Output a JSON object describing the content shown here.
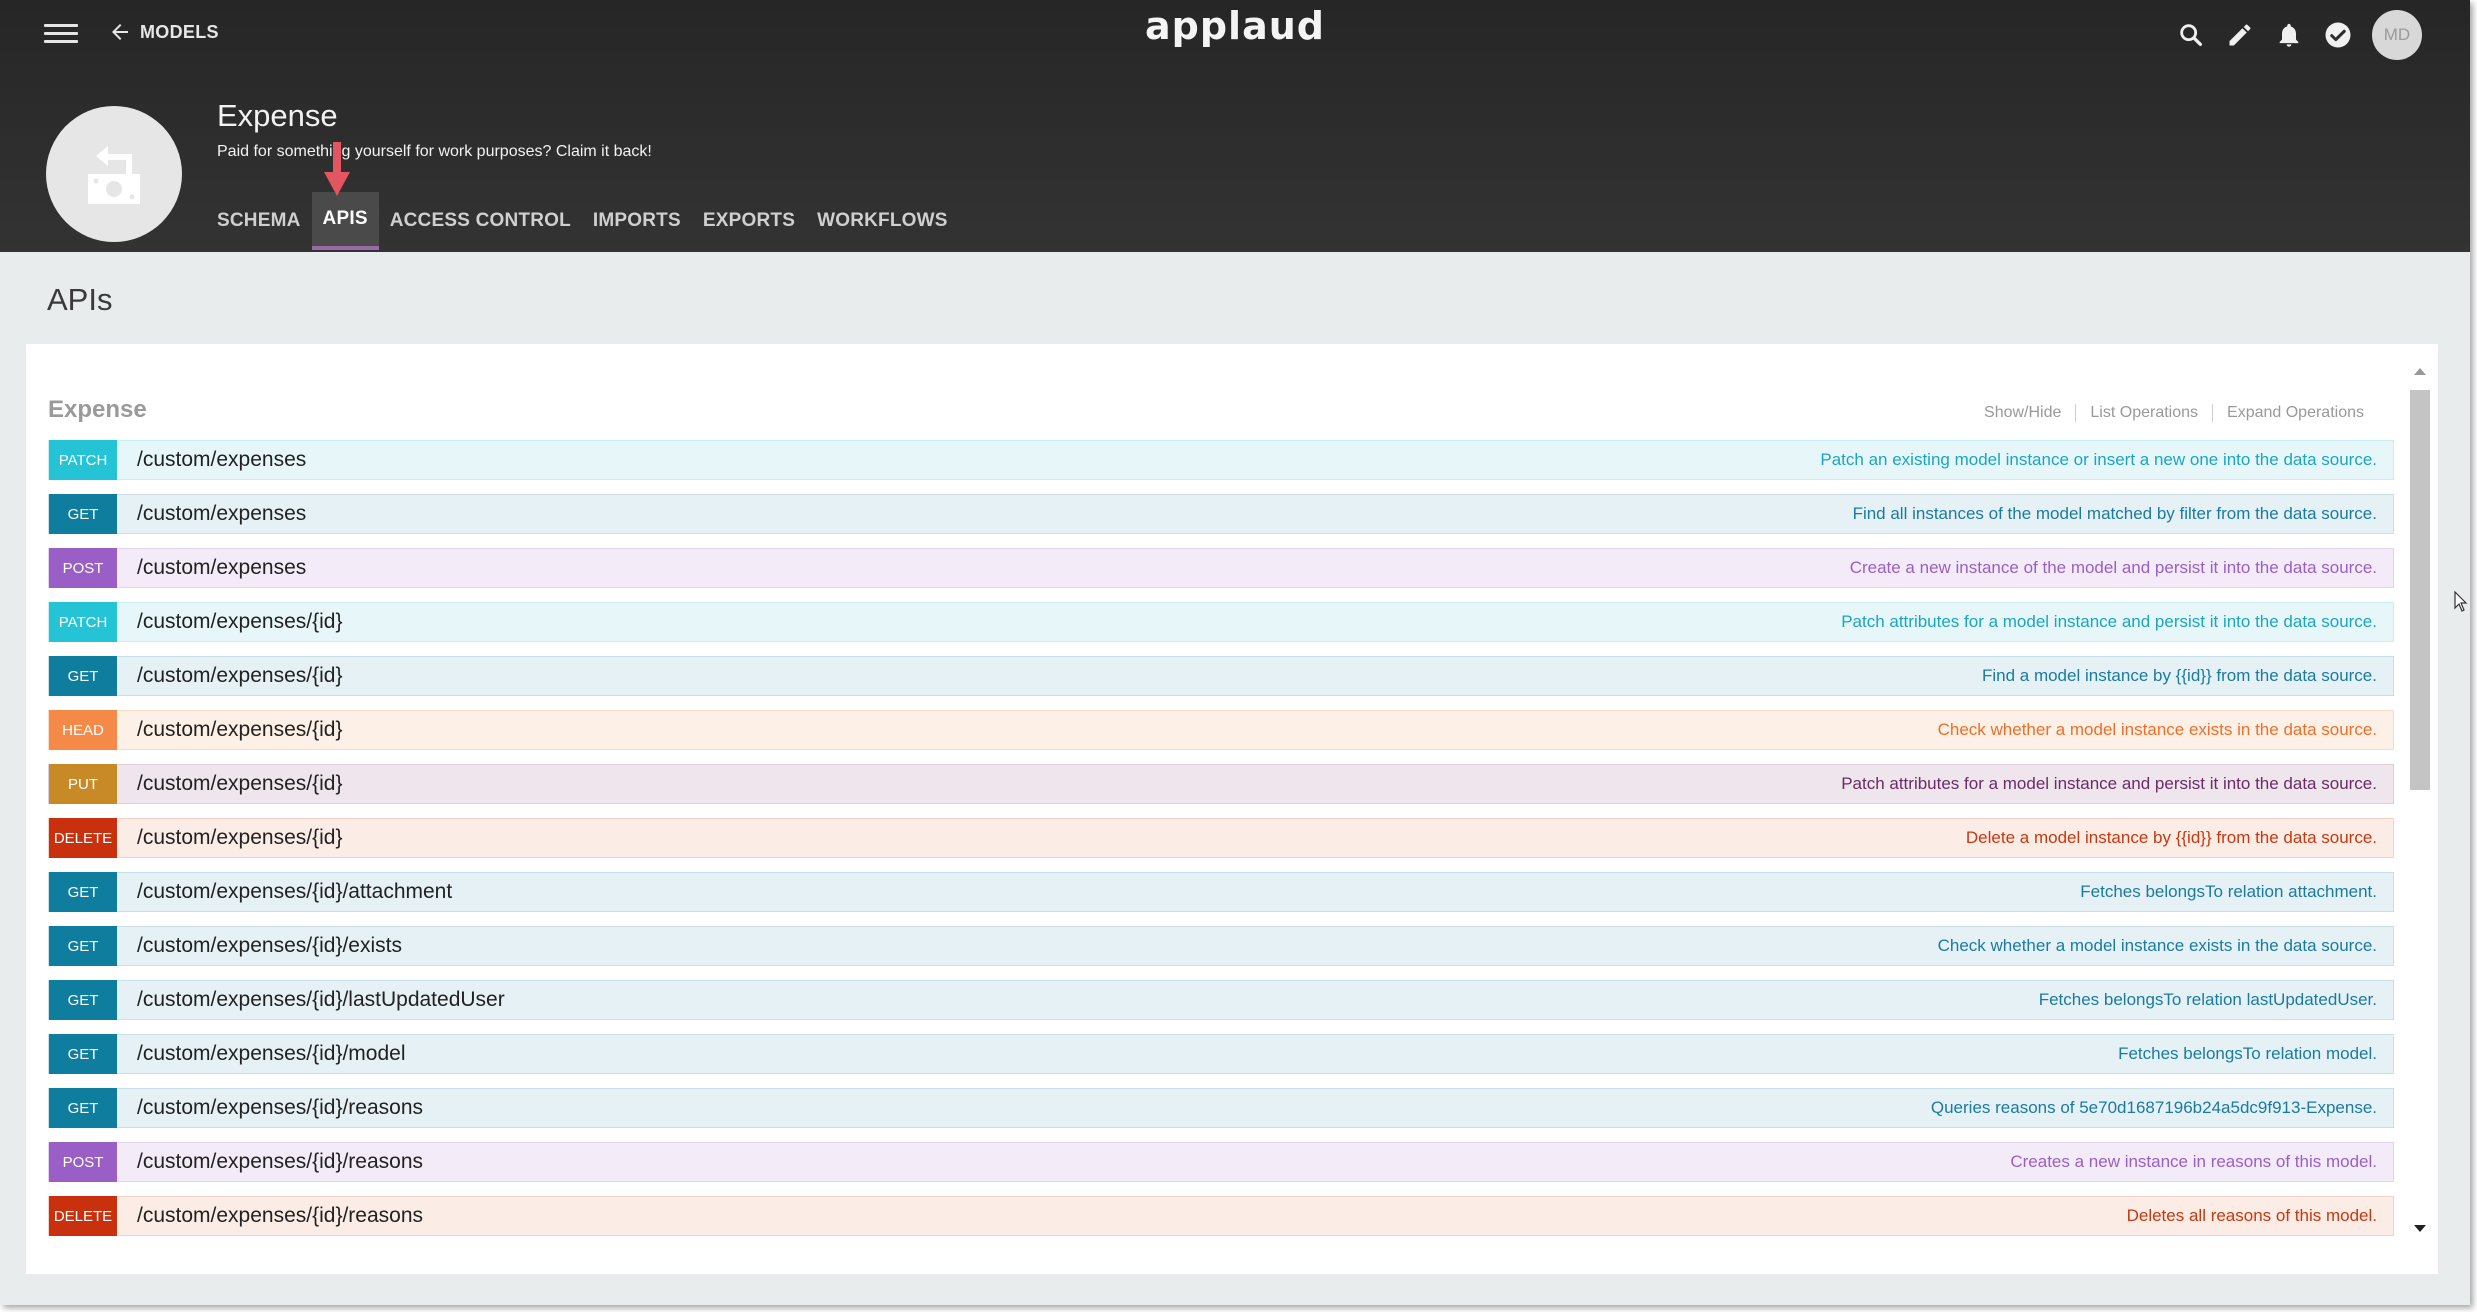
{
  "topbar": {
    "back_label": "MODELS",
    "brand": "applaud",
    "avatar_initials": "MD",
    "icons": [
      "search-icon",
      "edit-icon",
      "bell-icon",
      "check-circle-icon"
    ]
  },
  "model": {
    "title": "Expense",
    "description": "Paid for something yourself for work purposes? Claim it back!",
    "logo_icon": "cash-return-icon"
  },
  "tabs": [
    {
      "label": "SCHEMA",
      "active": false
    },
    {
      "label": "APIS",
      "active": true
    },
    {
      "label": "ACCESS CONTROL",
      "active": false
    },
    {
      "label": "IMPORTS",
      "active": false
    },
    {
      "label": "EXPORTS",
      "active": false
    },
    {
      "label": "WORKFLOWS",
      "active": false
    }
  ],
  "page": {
    "heading": "APIs",
    "group": {
      "title": "Expense",
      "actions": [
        "Show/Hide",
        "List Operations",
        "Expand Operations"
      ]
    }
  },
  "verb_styles": {
    "PATCH": {
      "badge": "#24c3d6",
      "row": "#e7f7f9",
      "text": "#1aa6c2",
      "border": "#c7eef3"
    },
    "GET": {
      "badge": "#0f7d9e",
      "row": "#e6f1f5",
      "text": "#1a7ba1",
      "border": "#c9e0e9"
    },
    "POST": {
      "badge": "#9a5fc6",
      "row": "#f3ecf8",
      "text": "#9a5fc6",
      "border": "#e2d3ee"
    },
    "HEAD": {
      "badge": "#f58a48",
      "row": "#fdf0e6",
      "text": "#ef6f2a",
      "border": "#f8dcc7"
    },
    "PUT": {
      "badge": "#c88a26",
      "row": "#eee6ec",
      "text": "#6b2c63",
      "border": "#ddd0da"
    },
    "DELETE": {
      "badge": "#c9310e",
      "row": "#fbece6",
      "text": "#c8380f",
      "border": "#f2d1c6"
    }
  },
  "operations": [
    {
      "verb": "PATCH",
      "path": "/custom/expenses",
      "summary": "Patch an existing model instance or insert a new one into the data source."
    },
    {
      "verb": "GET",
      "path": "/custom/expenses",
      "summary": "Find all instances of the model matched by filter from the data source."
    },
    {
      "verb": "POST",
      "path": "/custom/expenses",
      "summary": "Create a new instance of the model and persist it into the data source."
    },
    {
      "verb": "PATCH",
      "path": "/custom/expenses/{id}",
      "summary": "Patch attributes for a model instance and persist it into the data source."
    },
    {
      "verb": "GET",
      "path": "/custom/expenses/{id}",
      "summary": "Find a model instance by {{id}} from the data source."
    },
    {
      "verb": "HEAD",
      "path": "/custom/expenses/{id}",
      "summary": "Check whether a model instance exists in the data source."
    },
    {
      "verb": "PUT",
      "path": "/custom/expenses/{id}",
      "summary": "Patch attributes for a model instance and persist it into the data source."
    },
    {
      "verb": "DELETE",
      "path": "/custom/expenses/{id}",
      "summary": "Delete a model instance by {{id}} from the data source."
    },
    {
      "verb": "GET",
      "path": "/custom/expenses/{id}/attachment",
      "summary": "Fetches belongsTo relation attachment."
    },
    {
      "verb": "GET",
      "path": "/custom/expenses/{id}/exists",
      "summary": "Check whether a model instance exists in the data source."
    },
    {
      "verb": "GET",
      "path": "/custom/expenses/{id}/lastUpdatedUser",
      "summary": "Fetches belongsTo relation lastUpdatedUser."
    },
    {
      "verb": "GET",
      "path": "/custom/expenses/{id}/model",
      "summary": "Fetches belongsTo relation model."
    },
    {
      "verb": "GET",
      "path": "/custom/expenses/{id}/reasons",
      "summary": "Queries reasons of 5e70d1687196b24a5dc9f913-Expense."
    },
    {
      "verb": "POST",
      "path": "/custom/expenses/{id}/reasons",
      "summary": "Creates a new instance in reasons of this model."
    },
    {
      "verb": "DELETE",
      "path": "/custom/expenses/{id}/reasons",
      "summary": "Deletes all reasons of this model."
    }
  ]
}
